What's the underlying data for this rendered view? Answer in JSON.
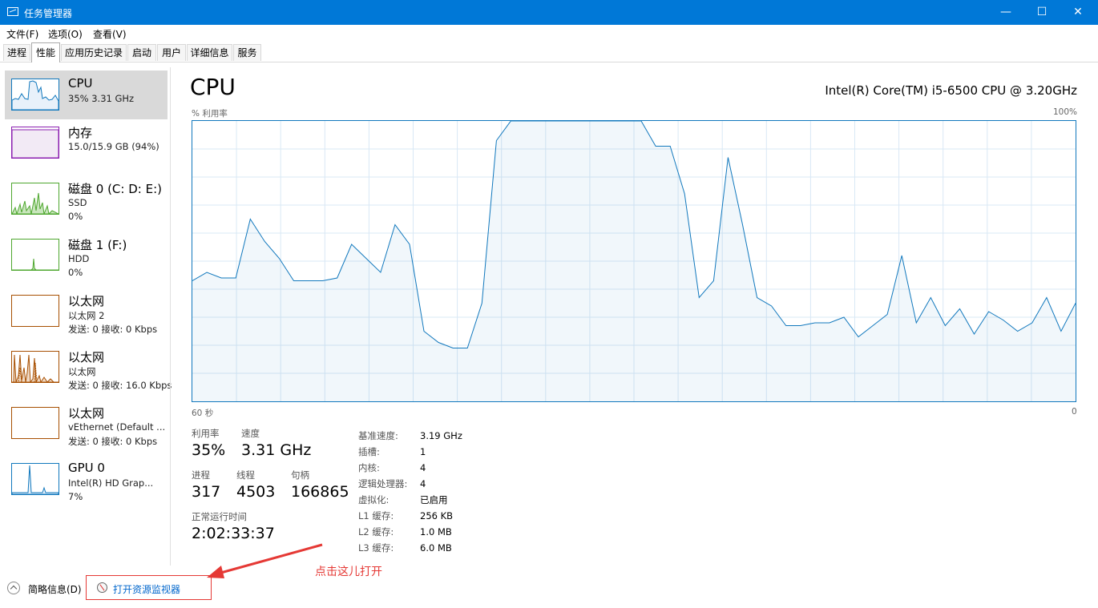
{
  "window": {
    "title": "任务管理器",
    "minimize": "—",
    "maximize": "☐",
    "close": "✕"
  },
  "menu": [
    "文件(F)",
    "选项(O)",
    "查看(V)"
  ],
  "tabs": [
    "进程",
    "性能",
    "应用历史记录",
    "启动",
    "用户",
    "详细信息",
    "服务"
  ],
  "active_tab": "性能",
  "sidebar": [
    {
      "name": "CPU",
      "sub1": "35%  3.31 GHz",
      "sub2": "",
      "color": "#1178bd",
      "selected": true
    },
    {
      "name": "内存",
      "sub1": "15.0/15.9 GB (94%)",
      "sub2": "",
      "color": "#8b1eb0",
      "selected": false
    },
    {
      "name": "磁盘 0 (C: D: E:)",
      "sub1": "SSD",
      "sub2": "0%",
      "color": "#4ea72e",
      "selected": false
    },
    {
      "name": "磁盘 1 (F:)",
      "sub1": "HDD",
      "sub2": "0%",
      "color": "#4ea72e",
      "selected": false
    },
    {
      "name": "以太网",
      "sub1": "以太网 2",
      "sub2": "发送: 0 接收: 0 Kbps",
      "color": "#a74f01",
      "selected": false
    },
    {
      "name": "以太网",
      "sub1": "以太网",
      "sub2": "发送: 0 接收: 16.0 Kbps",
      "color": "#a74f01",
      "selected": false
    },
    {
      "name": "以太网",
      "sub1": "vEthernet (Default ...",
      "sub2": "发送: 0 接收: 0 Kbps",
      "color": "#a74f01",
      "selected": false
    },
    {
      "name": "GPU 0",
      "sub1": "Intel(R) HD Grap...",
      "sub2": "7%",
      "color": "#1178bd",
      "selected": false
    }
  ],
  "cpu": {
    "title": "CPU",
    "model": "Intel(R) Core(TM) i5-6500 CPU @ 3.20GHz",
    "graph_label": "% 利用率",
    "graph_max": "100%",
    "time_left": "60 秒",
    "time_right": "0",
    "stats": {
      "util_label": "利用率",
      "util_value": "35%",
      "speed_label": "速度",
      "speed_value": "3.31 GHz",
      "proc_label": "进程",
      "proc_value": "317",
      "thread_label": "线程",
      "thread_value": "4503",
      "handle_label": "句柄",
      "handle_value": "166865",
      "uptime_label": "正常运行时间",
      "uptime_value": "2:02:33:37"
    },
    "specs": [
      {
        "k": "基准速度:",
        "v": "3.19 GHz"
      },
      {
        "k": "插槽:",
        "v": "1"
      },
      {
        "k": "内核:",
        "v": "4"
      },
      {
        "k": "逻辑处理器:",
        "v": "4"
      },
      {
        "k": "虚拟化:",
        "v": "已启用"
      },
      {
        "k": "L1 缓存:",
        "v": "256 KB"
      },
      {
        "k": "L2 缓存:",
        "v": "1.0 MB"
      },
      {
        "k": "L3 缓存:",
        "v": "6.0 MB"
      }
    ]
  },
  "chart_data": {
    "type": "area",
    "x": [
      60,
      59,
      58,
      57,
      56,
      55,
      54,
      53,
      52,
      51,
      50,
      49,
      48,
      47,
      46,
      45,
      44,
      43,
      42,
      41,
      40,
      39,
      38,
      37,
      36,
      35,
      34,
      33,
      32,
      31,
      30,
      29,
      28,
      27,
      26,
      25,
      24,
      23,
      22,
      21,
      20,
      19,
      18,
      17,
      16,
      15,
      14,
      13,
      12,
      11,
      10,
      9,
      8,
      7,
      6,
      5,
      4,
      3,
      2,
      1,
      0
    ],
    "series": [
      {
        "values": [
          43,
          46,
          44,
          44,
          65,
          57,
          51,
          43,
          43,
          43,
          44,
          56,
          51,
          46,
          63,
          56,
          25,
          21,
          19,
          19,
          35,
          93,
          100,
          100,
          100,
          100,
          100,
          100,
          100,
          100,
          100,
          100,
          91,
          91,
          74,
          37,
          43,
          87,
          63,
          37,
          34,
          27,
          27,
          28,
          28,
          30,
          23,
          27,
          31,
          52,
          28,
          37,
          27,
          33,
          24,
          32,
          29,
          25,
          28,
          37,
          25,
          35
        ]
      }
    ],
    "ylim": [
      0,
      100
    ],
    "xlim": [
      60,
      0
    ]
  },
  "footer": {
    "fewer_details": "简略信息(D)",
    "open_monitor": "打开资源监视器",
    "annotation": "点击这儿打开"
  }
}
